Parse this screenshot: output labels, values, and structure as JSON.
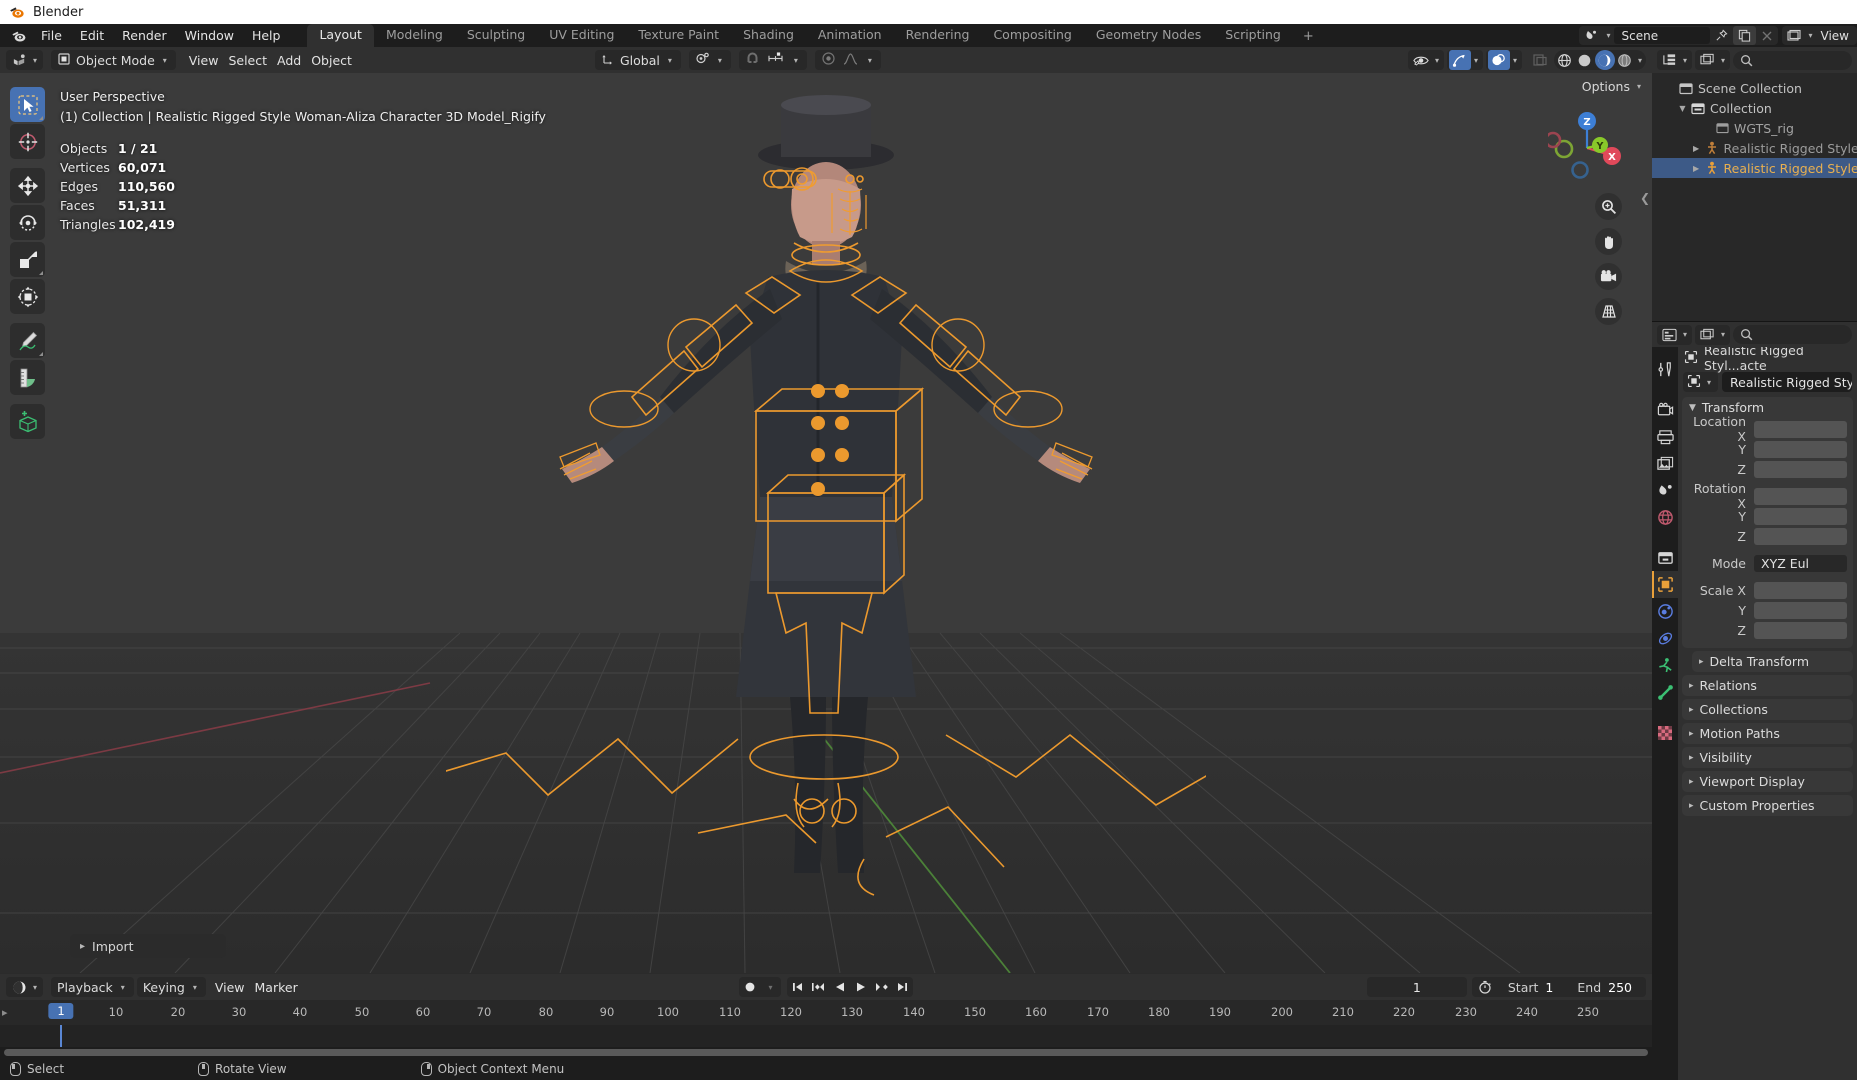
{
  "window": {
    "title": "Blender",
    "logo_icon": "blender-logo-icon"
  },
  "menubar": {
    "items": [
      {
        "label": "File",
        "name": "menu-file"
      },
      {
        "label": "Edit",
        "name": "menu-edit"
      },
      {
        "label": "Render",
        "name": "menu-render"
      },
      {
        "label": "Window",
        "name": "menu-window"
      },
      {
        "label": "Help",
        "name": "menu-help"
      }
    ],
    "workspace_tabs": [
      {
        "label": "Layout",
        "active": true
      },
      {
        "label": "Modeling",
        "active": false
      },
      {
        "label": "Sculpting",
        "active": false
      },
      {
        "label": "UV Editing",
        "active": false
      },
      {
        "label": "Texture Paint",
        "active": false
      },
      {
        "label": "Shading",
        "active": false
      },
      {
        "label": "Animation",
        "active": false
      },
      {
        "label": "Rendering",
        "active": false
      },
      {
        "label": "Compositing",
        "active": false
      },
      {
        "label": "Geometry Nodes",
        "active": false
      },
      {
        "label": "Scripting",
        "active": false
      }
    ],
    "add_tab_label": "+",
    "scene": {
      "name": "Scene",
      "icon": "scene-icon",
      "pin_icon": "pin-icon",
      "copy_icon": "duplicate-icon",
      "close_icon": "close-icon"
    },
    "view_layer": {
      "name": "View",
      "icon": "view-layer-icon"
    }
  },
  "viewport_header": {
    "editor_type_icon": "editor-type-3dview-icon",
    "mode": {
      "label": "Object Mode",
      "icon": "object-mode-icon"
    },
    "menus": [
      {
        "label": "View",
        "name": "viewport-menu-view"
      },
      {
        "label": "Select",
        "name": "viewport-menu-select"
      },
      {
        "label": "Add",
        "name": "viewport-menu-add"
      },
      {
        "label": "Object",
        "name": "viewport-menu-object"
      }
    ],
    "transform_orientation": {
      "label": "Global",
      "icon": "orientation-icon"
    },
    "snap": {
      "icon": "magnet-icon",
      "target_icon": "snap-target-icon",
      "enabled": false
    },
    "proportional_edit": {
      "icon": "proportional-edit-icon",
      "falloff_icon": "falloff-curve-icon",
      "enabled": false
    },
    "pivot": {
      "icon": "pivot-icon"
    },
    "visibility_icons": [
      "show-object-types-icon",
      "gizmo-icon",
      "overlays-icon",
      "xray-icon"
    ],
    "shading_modes": [
      "wireframe-shading-icon",
      "solid-shading-icon",
      "material-preview-icon",
      "rendered-shading-icon"
    ],
    "active_shading": "material-preview-icon",
    "options_label": "Options"
  },
  "toolbar": {
    "tools": [
      {
        "name": "tweak-select-box-tool",
        "icon": "cursor-arrow-box-icon",
        "active": true
      },
      {
        "name": "cursor-tool",
        "icon": "3d-cursor-icon",
        "active": false
      },
      {
        "name": "move-tool",
        "icon": "move-arrows-icon",
        "active": false
      },
      {
        "name": "rotate-tool",
        "icon": "rotate-icon",
        "active": false
      },
      {
        "name": "scale-tool",
        "icon": "scale-icon",
        "active": false
      },
      {
        "name": "transform-tool",
        "icon": "transform-icon",
        "active": false
      },
      {
        "name": "annotate-tool",
        "icon": "pencil-icon",
        "active": false
      },
      {
        "name": "measure-tool",
        "icon": "ruler-icon",
        "active": false
      },
      {
        "name": "add-cube-tool",
        "icon": "add-cube-icon",
        "active": false
      }
    ]
  },
  "viewport_overlay": {
    "perspective": "User Perspective",
    "breadcrumb": "(1) Collection | Realistic Rigged Style Woman-Aliza Character 3D Model_Rigify",
    "stats": [
      {
        "key": "Objects",
        "value": "1 / 21"
      },
      {
        "key": "Vertices",
        "value": "60,071"
      },
      {
        "key": "Edges",
        "value": "110,560"
      },
      {
        "key": "Faces",
        "value": "51,311"
      },
      {
        "key": "Triangles",
        "value": "102,419"
      }
    ],
    "operator_panel": {
      "label": "Import",
      "icon": "chevron-right-icon"
    },
    "gizmo_axes": [
      {
        "label": "Z",
        "color": "#3d7fd6"
      },
      {
        "label": "Y",
        "color": "#89c92a"
      },
      {
        "label": "X",
        "color": "#e0495a"
      }
    ],
    "nav_buttons": [
      {
        "name": "zoom-viewport-button",
        "icon": "magnifier-plus-icon"
      },
      {
        "name": "pan-viewport-button",
        "icon": "hand-icon"
      },
      {
        "name": "camera-view-button",
        "icon": "camera-icon"
      },
      {
        "name": "toggle-perspective-button",
        "icon": "grid-perspective-icon"
      }
    ]
  },
  "outliner": {
    "display_mode_icon": "outliner-display-mode-icon",
    "filter_icon": "filter-icon",
    "search_placeholder": "",
    "search_icon": "search-icon",
    "rows": [
      {
        "indent": 0,
        "tri": "",
        "icon": "scene-collection-icon",
        "label": "Scene Collection",
        "selected": false
      },
      {
        "indent": 1,
        "tri": "▼",
        "icon": "collection-icon",
        "label": "Collection",
        "selected": false
      },
      {
        "indent": 2,
        "tri": "",
        "icon": "collection-icon",
        "label": "WGTS_rig",
        "selected": false
      },
      {
        "indent": 2,
        "tri": "▶",
        "icon": "armature-icon",
        "label": "Realistic Rigged Style ",
        "selected": false
      },
      {
        "indent": 2,
        "tri": "▶",
        "icon": "armature-icon",
        "label": "Realistic Rigged Style ",
        "selected": true
      }
    ]
  },
  "properties": {
    "editor_icon": "properties-editor-icon",
    "tool_icon": "tool-icon",
    "search_icon": "search-icon",
    "tabs": [
      {
        "name": "tab-tool",
        "icon": "wrench-screwdriver-icon",
        "color": "#d8d8d8",
        "active": false
      },
      {
        "name": "tab-render",
        "icon": "camera-back-icon",
        "color": "#d8d8d8",
        "active": false
      },
      {
        "name": "tab-output",
        "icon": "printer-icon",
        "color": "#d8d8d8",
        "active": false
      },
      {
        "name": "tab-view-layer",
        "icon": "images-icon",
        "color": "#d8d8d8",
        "active": false
      },
      {
        "name": "tab-scene",
        "icon": "scene-cone-icon",
        "color": "#d8d8d8",
        "active": false
      },
      {
        "name": "tab-world",
        "icon": "world-globe-icon",
        "color": "#c05a6e",
        "active": false
      },
      {
        "name": "tab-collection",
        "icon": "collection-box-icon",
        "color": "#d8d8d8",
        "active": false
      },
      {
        "name": "tab-object",
        "icon": "object-square-icon",
        "color": "#e9a03a",
        "active": true
      },
      {
        "name": "tab-modifiers",
        "icon": "wrench-blue-icon",
        "color": "#5a7de0",
        "active": false
      },
      {
        "name": "tab-physics",
        "icon": "physics-orbit-icon",
        "color": "#5a7de0",
        "active": false
      },
      {
        "name": "tab-constraints",
        "icon": "constraint-runner-icon",
        "color": "#3bbf73",
        "active": false
      },
      {
        "name": "tab-data",
        "icon": "bone-icon",
        "color": "#3bbf73",
        "active": false
      },
      {
        "name": "tab-material",
        "icon": "checker-material-icon",
        "color": "#c05a6e",
        "active": false
      }
    ],
    "breadcrumb": {
      "icon": "object-square-icon",
      "label": "Realistic Rigged Styl...acte"
    },
    "id_block": {
      "icon": "object-square-icon",
      "name": "Realistic Rigged Styl...ct"
    },
    "transform_panel": {
      "title": "Transform",
      "rows": [
        {
          "label": "Location X",
          "value": ""
        },
        {
          "label": "Y",
          "value": ""
        },
        {
          "label": "Z",
          "value": ""
        },
        {
          "label": "Rotation X",
          "value": ""
        },
        {
          "label": "Y",
          "value": ""
        },
        {
          "label": "Z",
          "value": ""
        }
      ],
      "mode": {
        "label": "Mode",
        "value": "XYZ Eul"
      },
      "scale_rows": [
        {
          "label": "Scale X",
          "value": ""
        },
        {
          "label": "Y",
          "value": ""
        },
        {
          "label": "Z",
          "value": ""
        }
      ]
    },
    "collapsed_panels": [
      {
        "label": "Delta Transform",
        "indent": true
      },
      {
        "label": "Relations",
        "indent": false
      },
      {
        "label": "Collections",
        "indent": false
      },
      {
        "label": "Motion Paths",
        "indent": false
      },
      {
        "label": "Visibility",
        "indent": false
      },
      {
        "label": "Viewport Display",
        "indent": false
      },
      {
        "label": "Custom Properties",
        "indent": false
      }
    ]
  },
  "timeline": {
    "editor_icon": "timeline-editor-icon",
    "menus": [
      {
        "label": "Playback",
        "name": "timeline-menu-playback",
        "has_caret": true
      },
      {
        "label": "Keying",
        "name": "timeline-menu-keying",
        "has_caret": true
      },
      {
        "label": "View",
        "name": "timeline-menu-view",
        "has_caret": false
      },
      {
        "label": "Marker",
        "name": "timeline-menu-marker",
        "has_caret": false
      }
    ],
    "record_icon": "record-icon",
    "transport": [
      "jump-to-start-icon",
      "jump-to-prev-keyframe-icon",
      "play-reverse-icon",
      "play-icon",
      "jump-to-next-keyframe-icon",
      "jump-to-end-icon"
    ],
    "current_frame": "1",
    "stopwatch_icon": "stopwatch-icon",
    "start_label": "Start",
    "start_value": "1",
    "end_label": "End",
    "end_value": "250",
    "ticks": [
      "1",
      "10",
      "20",
      "30",
      "40",
      "50",
      "60",
      "70",
      "80",
      "90",
      "100",
      "110",
      "120",
      "130",
      "140",
      "150",
      "160",
      "170",
      "180",
      "190",
      "200",
      "210",
      "220",
      "230",
      "240",
      "250"
    ],
    "playhead_frame": "1",
    "expand_icon": "chevron-right-icon"
  },
  "statusbar": {
    "items": [
      {
        "icon": "mouse-left-icon",
        "label": "Select"
      },
      {
        "icon": "mouse-middle-icon",
        "label": "Rotate View"
      },
      {
        "icon": "mouse-right-icon",
        "label": "Object Context Menu"
      }
    ]
  },
  "colors": {
    "accent_blue": "#4772b3",
    "select_orange": "#e9a03a",
    "outliner_selected": "#3d5a87",
    "panel_bg": "#303030",
    "editor_bg": "#282828",
    "window_bg": "#1d1d1d"
  }
}
